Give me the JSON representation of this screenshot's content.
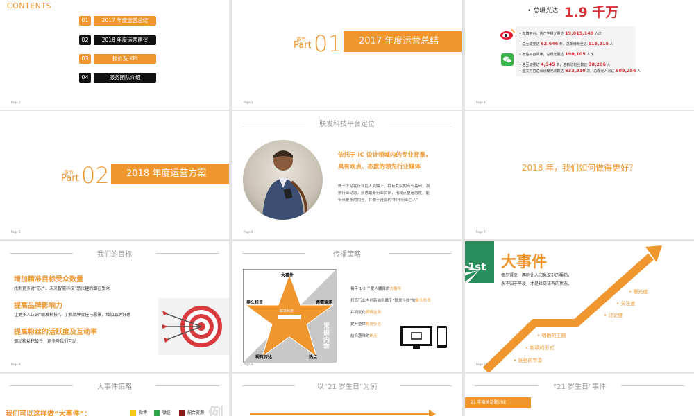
{
  "contents": {
    "title": "CONTENTS",
    "items": [
      {
        "num": "01",
        "label": "2017 年度运营总结",
        "style": "orange"
      },
      {
        "num": "02",
        "label": "2018 年度运营建议",
        "style": "black"
      },
      {
        "num": "03",
        "label": "报价及 KPI",
        "style": "orange"
      },
      {
        "num": "04",
        "label": "服务团队介绍",
        "style": "black"
      }
    ],
    "page": "Page 2"
  },
  "part1": {
    "chapter": "章节",
    "part_word": "Part",
    "num": "01",
    "title": "2017 年度运营总结",
    "page": "Page 3"
  },
  "exposure": {
    "label": "总曝光达:",
    "value": "1.9 千万",
    "weibo_rows": [
      {
        "pre": "微博平台，共产生曝光量达",
        "num": "19,015,149",
        "post": "人次"
      },
      {
        "pre": "总互动量达",
        "num": "62,646",
        "mid": "条，总新增粉丝达",
        "num2": "115,315",
        "post": "人"
      }
    ],
    "wechat_rows": [
      {
        "pre": "微信平台阅读，总曝光量达",
        "num": "190,105",
        "post": "人次"
      },
      {
        "pre": "总互动量达",
        "num": "4,345",
        "mid": "条，总新增粉丝数达",
        "num2": "30,206",
        "post": "人"
      },
      {
        "pre": "图文内容总阅读曝光次数达",
        "num": "633,310",
        "mid": "次，总曝光人次达",
        "num2": "509,256",
        "post": "人"
      }
    ],
    "page": "Page 4"
  },
  "part2": {
    "chapter": "章节",
    "part_word": "Part",
    "num": "02",
    "title": "2018 年度运营方案",
    "page": "Page 5"
  },
  "positioning": {
    "header": "联发科技平台定位",
    "headline_1": "依托于 IC 设计领域内的专业背景，",
    "headline_2": "具有观点、态度的领先行业媒体",
    "body_1": "做一个站在行业巨人肩膀上，拥有夯实的专业基础，洞",
    "body_2": "察行业动态，获悉最新行业资讯，用观点塑造态度，能",
    "body_3": "带来更多的内容，并做于社会的“科技行业巨人”",
    "page": "Page 6"
  },
  "question": {
    "text": "2018 年，我们如何做得更好？",
    "page": "Page 7"
  },
  "goals": {
    "header": "我们的目标",
    "items": [
      {
        "title": "增加精准目标受众数量",
        "desc": "找到更多对“芯片、未来智能科技”感兴趣的潜在受众"
      },
      {
        "title": "提高品牌影响力",
        "desc": "让更多人认识“联发科技”，了解品牌责任与愿景，增加品牌好感"
      },
      {
        "title": "提高粉丝的活跃度及互动率",
        "desc": "调动粉丝积极性，更多与我们互动"
      }
    ],
    "page": "Page 8"
  },
  "strategy": {
    "header": "传播策略",
    "star_labels": {
      "top": "大事件",
      "left": "拳头栏目",
      "right": "舆情监测",
      "bottom_left": "视觉传达",
      "bottom_right": "热点",
      "center": "联发科技",
      "side": "常规内容"
    },
    "list": [
      {
        "pre": "每年 1-2 个受人瞩目的",
        "hl": "大事件"
      },
      {
        "pre": "打造行业内创新独到属于“联发科技”的",
        "hl": "拳头栏目"
      },
      {
        "pre": "并拥优化",
        "hl": "舆情监测"
      },
      {
        "pre": "提升整体",
        "hl": "视觉传达"
      },
      {
        "pre": "结合趣味的",
        "hl": "热点"
      }
    ],
    "page": "Page 9"
  },
  "big_event": {
    "rank": "1st",
    "title": "大事件",
    "desc_1": "偶尔得来一两则让人印象深刻的猛药，",
    "desc_2": "永不归于平淡，才是社交该有的状态。",
    "points": [
      "曝光度",
      "关注度",
      "讨论度",
      "明确的主题",
      "新颖的形式",
      "张弛的节奏"
    ],
    "page": "Page 10"
  },
  "event_strategy": {
    "header": "大事件策略",
    "lead": "我们可以这样做“大事件”：",
    "legend": [
      {
        "label": "微博",
        "color": "#f5c518"
      },
      {
        "label": "微信",
        "color": "#2aa745"
      },
      {
        "label": "配合资源",
        "color": "#8b1a1a"
      }
    ],
    "watermark": "例"
  },
  "example": {
    "header": "以“21 岁生日”为例"
  },
  "birthday": {
    "header": "“21 岁生日”事件",
    "tag": "21 年相关话题讨论"
  }
}
